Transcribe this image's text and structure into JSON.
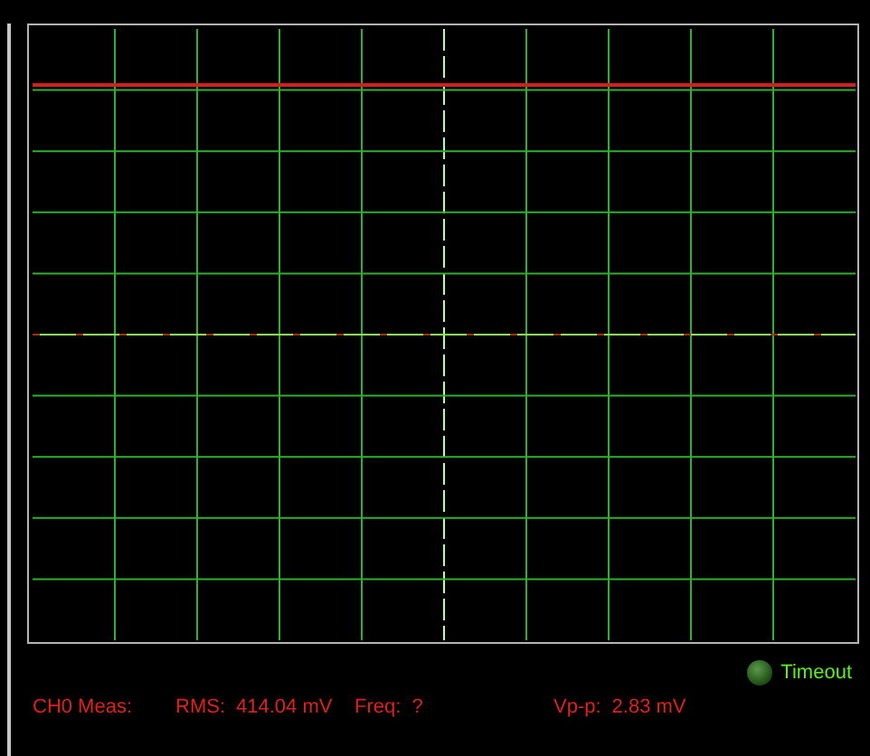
{
  "indicator": {
    "label": "Timeout",
    "on": false
  },
  "measurements": [
    {
      "label": "CH0 Meas:"
    },
    {
      "label": "RMS:",
      "value": "414.04 mV"
    },
    {
      "label": "Freq:",
      "value": "?"
    },
    {
      "label": "Vp-p:",
      "value": "2.83 mV"
    }
  ]
}
